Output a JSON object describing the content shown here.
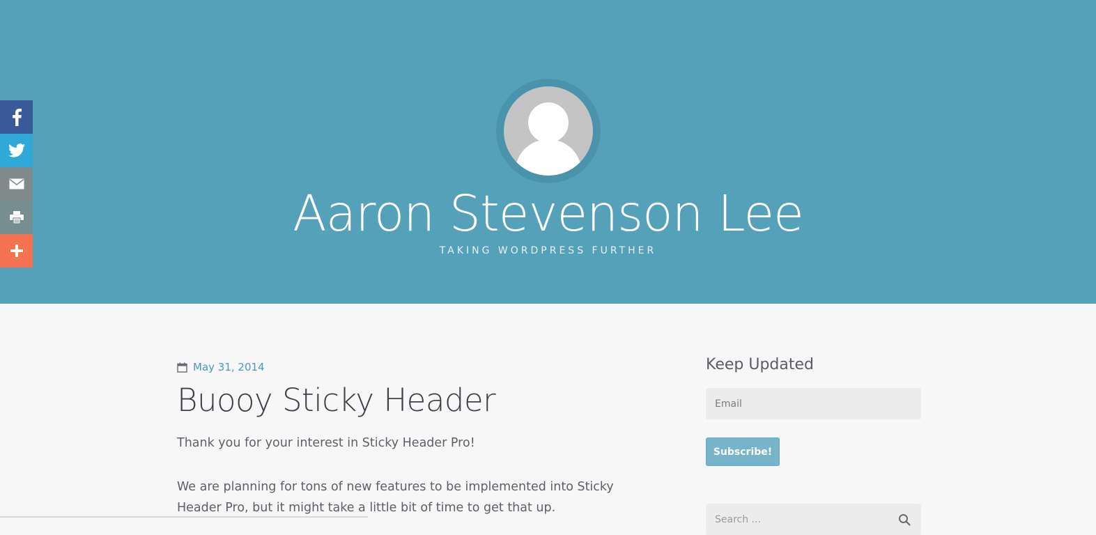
{
  "colors": {
    "hero_bg": "#55a1b9",
    "page_bg": "#f7f7f7",
    "accent": "#4a9bb6",
    "facebook": "#3b5a9a",
    "twitter": "#2fa9d8",
    "email": "#818a8a",
    "print": "#768e90",
    "more": "#f4724f",
    "subscribe_button": "#75b4c9"
  },
  "header": {
    "site_title": "Aaron Stevenson Lee",
    "tagline": "TAKING WORDPRESS FURTHER",
    "avatar_icon": "default-user-avatar"
  },
  "share_bar": {
    "items": [
      {
        "icon": "facebook-icon"
      },
      {
        "icon": "twitter-icon"
      },
      {
        "icon": "email-icon"
      },
      {
        "icon": "print-icon"
      },
      {
        "icon": "plus-icon"
      }
    ]
  },
  "post": {
    "date_icon": "calendar-icon",
    "date": "May 31, 2014",
    "title": "Buooy Sticky Header",
    "paragraphs": [
      "Thank you for your interest in Sticky Header Pro!",
      "We are planning for tons of new features to be implemented into Sticky Header Pro, but it might take a little bit of time to get that up."
    ]
  },
  "sidebar": {
    "subscribe_widget": {
      "title": "Keep Updated",
      "email_placeholder": "Email",
      "button_label": "Subscribe!"
    },
    "search_widget": {
      "placeholder": "Search ...",
      "icon": "search-icon"
    }
  }
}
